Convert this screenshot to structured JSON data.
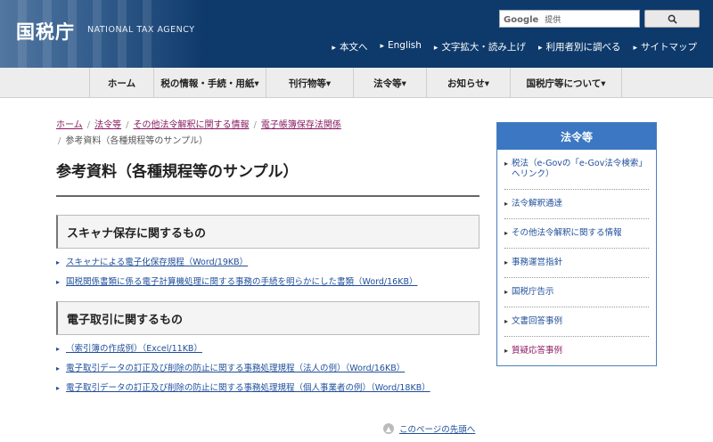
{
  "header": {
    "logo": "国税庁",
    "logo_en": "NATIONAL TAX AGENCY",
    "search_brand": "Google",
    "search_placeholder": "提供",
    "search_button_icon": "search-icon",
    "util_links": [
      "本文へ",
      "English",
      "文字拡大・読み上げ",
      "利用者別に調べる",
      "サイトマップ"
    ]
  },
  "gnav": {
    "items": [
      "ホーム",
      "税の情報・手続・用紙▾",
      "刊行物等▾",
      "法令等▾",
      "お知らせ▾",
      "国税庁等について▾"
    ]
  },
  "breadcrumb": {
    "items": [
      "ホーム",
      "法令等",
      "その他法令解釈に関する情報",
      "電子帳簿保存法関係"
    ],
    "current": "参考資料（各種規程等のサンプル）"
  },
  "page_title": "参考資料（各種規程等のサンプル）",
  "sections": [
    {
      "title": "スキャナ保存に関するもの",
      "links": [
        "スキャナによる電子化保存規程（Word/19KB）",
        "国税関係書類に係る電子計算機処理に関する事務の手続を明らかにした書類（Word/16KB）"
      ]
    },
    {
      "title": "電子取引に関するもの",
      "links": [
        "（索引簿の作成例）（Excel/11KB）",
        "電子取引データの訂正及び削除の防止に関する事務処理規程（法人の例）（Word/16KB）",
        "電子取引データの訂正及び削除の防止に関する事務処理規程（個人事業者の例）（Word/18KB）"
      ]
    }
  ],
  "pagetop": "このページの先頭へ",
  "side": {
    "title": "法令等",
    "items": [
      "税法（e-Govの「e-Gov法令検索」へリンク）",
      "法令解釈通達",
      "その他法令解釈に関する情報",
      "事務運営指針",
      "国税庁告示",
      "文書回答事例",
      "質疑応答事例"
    ]
  },
  "colors": {
    "header_bg": "#0e3a6b",
    "accent": "#3b77c2",
    "visited": "#8a1a62",
    "link": "#1f4e9a"
  }
}
